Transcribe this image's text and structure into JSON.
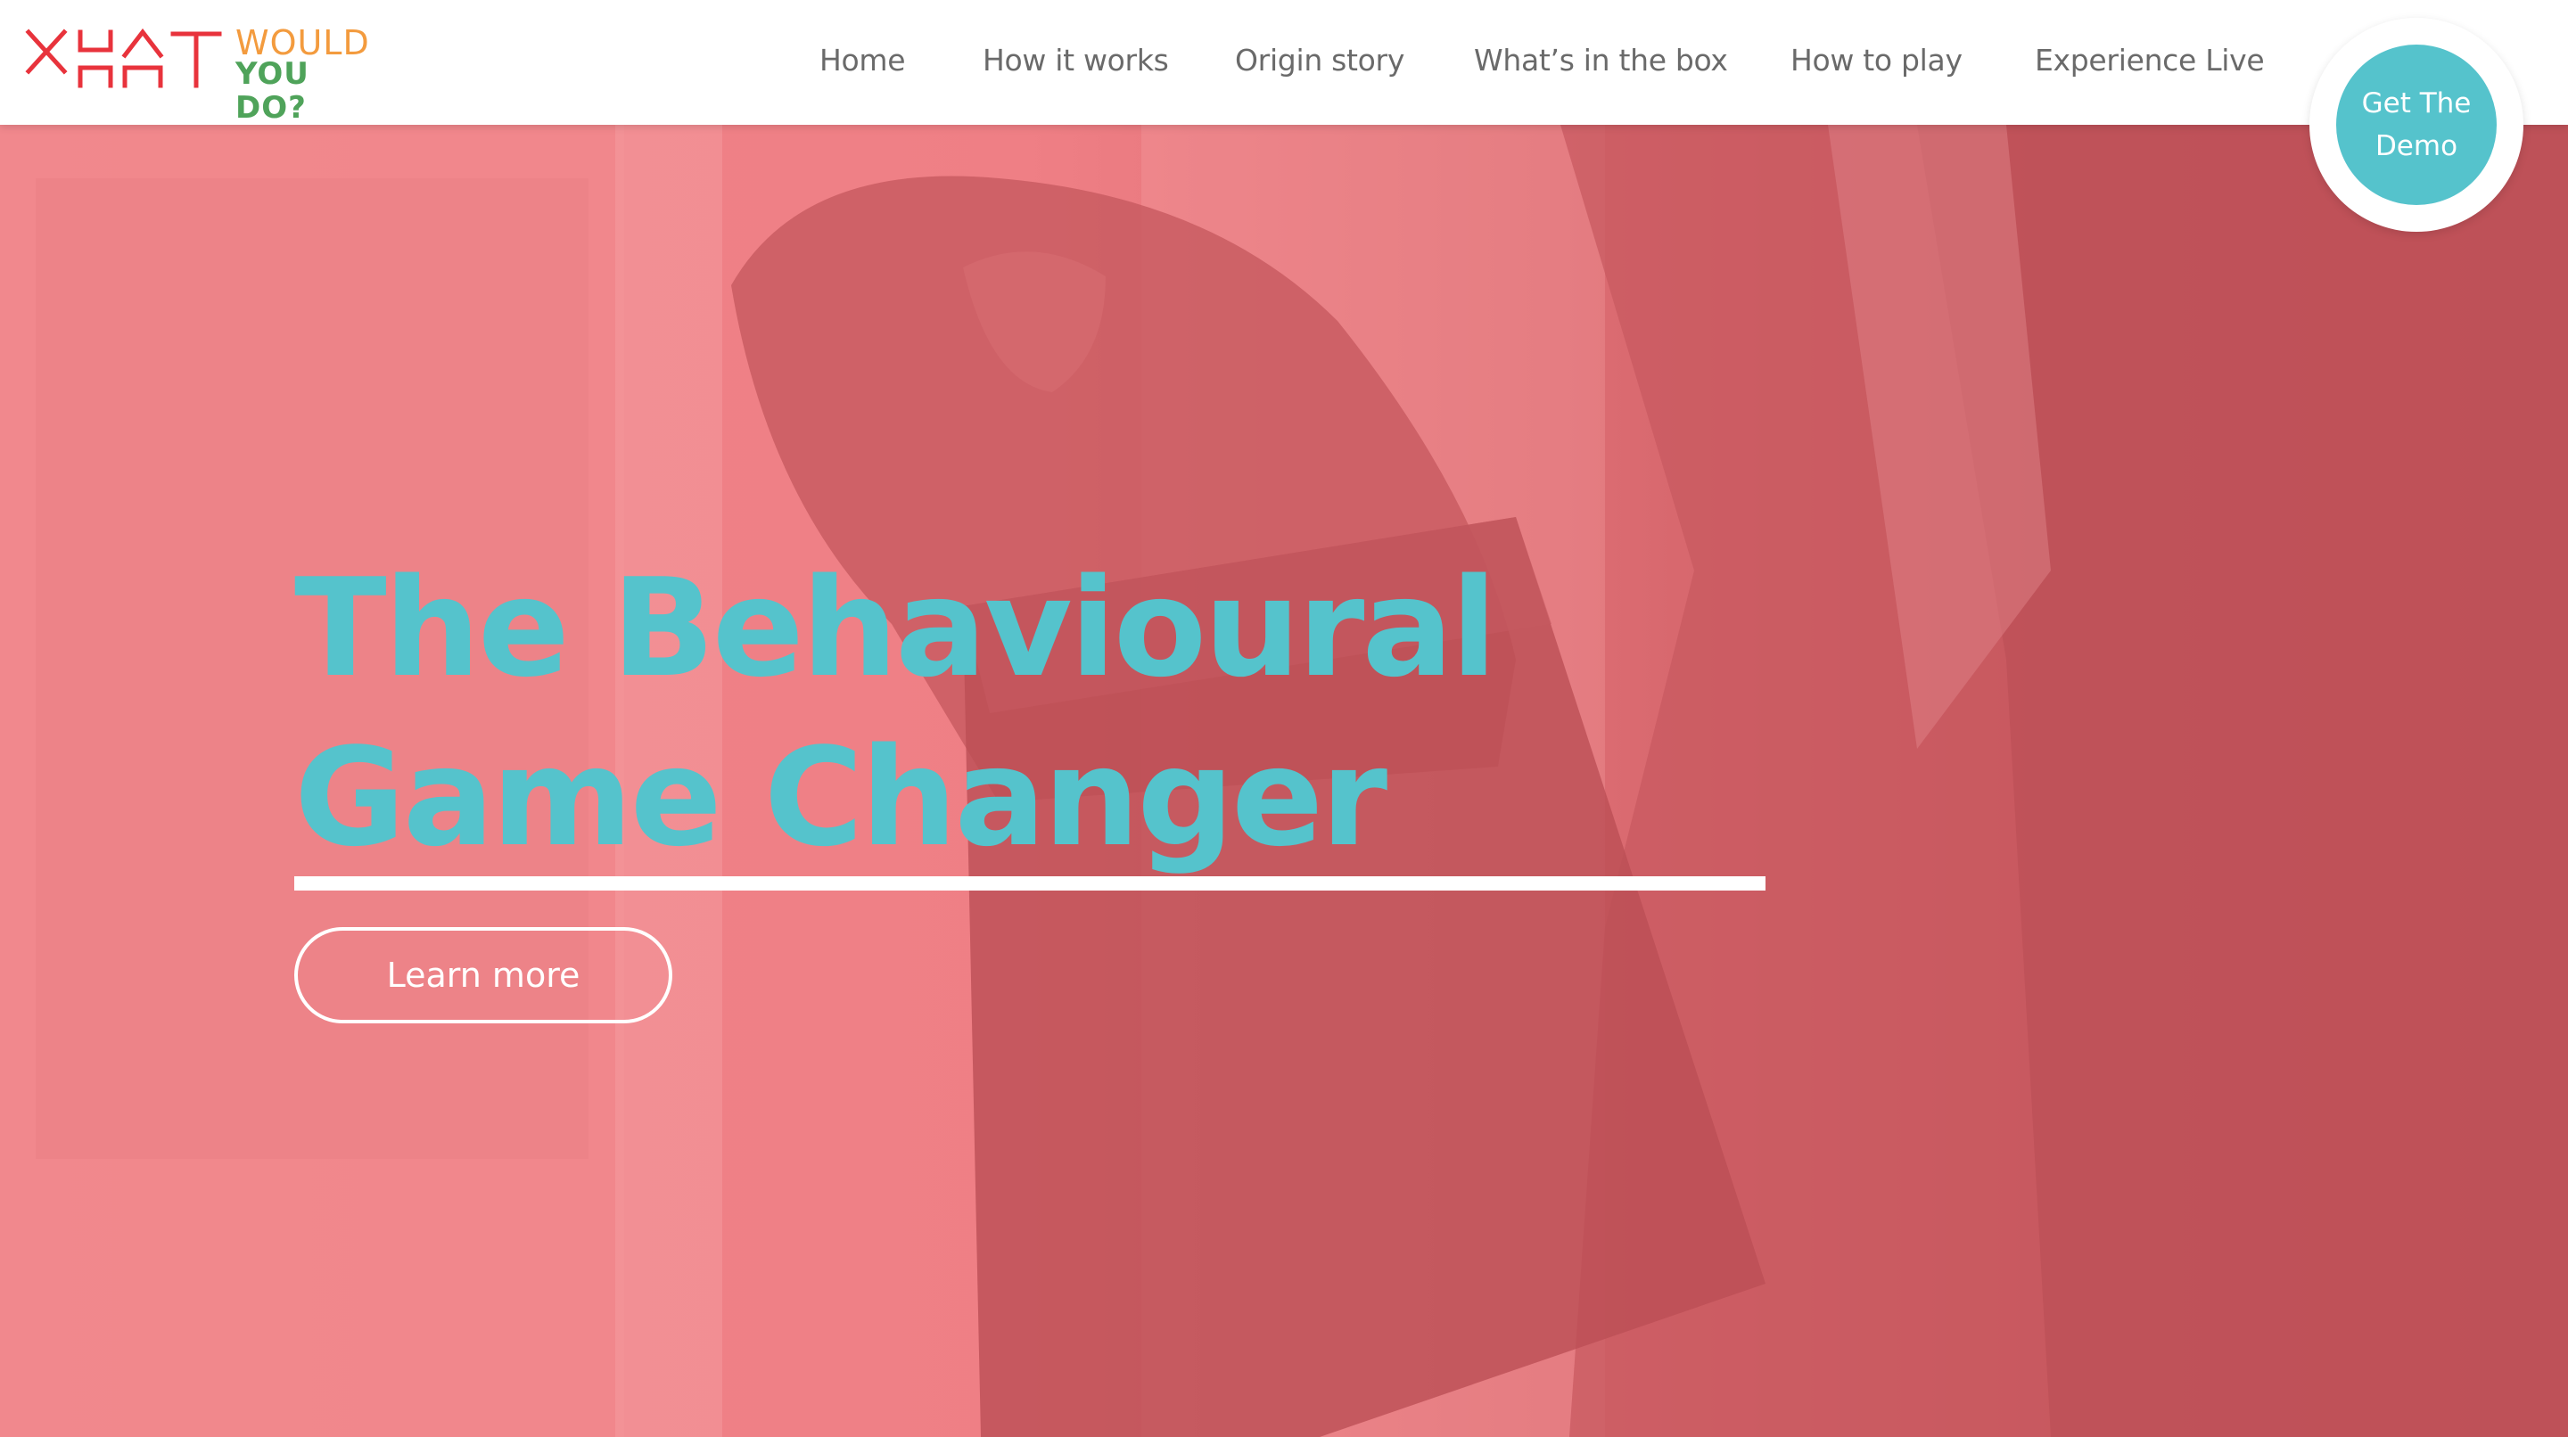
{
  "brand": {
    "logo_word_1": "WHAT",
    "logo_word_2": "WOULD",
    "logo_word_3": "YOU DO?",
    "colors": {
      "what": "#e8333c",
      "would": "#f39b3e",
      "you_do": "#4fa35a"
    }
  },
  "nav": {
    "items": [
      {
        "label": "Home"
      },
      {
        "label": "How it works"
      },
      {
        "label": "Origin story"
      },
      {
        "label": "What’s in the box"
      },
      {
        "label": "How to play"
      },
      {
        "label": "Experience Live"
      }
    ],
    "cta_label": "Get The Demo"
  },
  "hero": {
    "headline_line_1": "The Behavioural",
    "headline_line_2": "Game Changer",
    "button_label": "Learn more"
  },
  "colors": {
    "accent": "#55c3cc",
    "overlay": "#f08085",
    "header_bg": "#ffffff",
    "nav_text": "#6a6a6a"
  }
}
